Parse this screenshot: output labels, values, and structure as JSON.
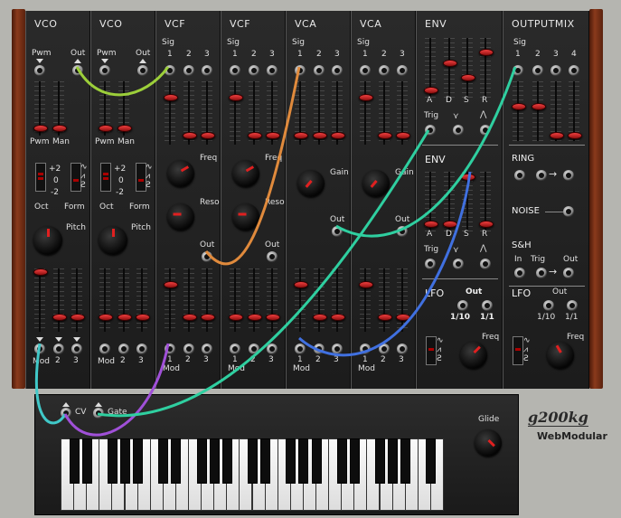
{
  "modules": {
    "vco1": {
      "title": "VCO",
      "pwm": "Pwm",
      "out": "Out",
      "pwm_label": "Pwm",
      "man_label": "Man",
      "oct": "Oct",
      "form": "Form",
      "pitch": "Pitch",
      "mod": "Mod",
      "n2": "2",
      "n3": "3",
      "plus2": "+2",
      "zero": "0",
      "minus2": "-2"
    },
    "vco2": {
      "title": "VCO",
      "pwm": "Pwm",
      "out": "Out",
      "pwm_label": "Pwm",
      "man_label": "Man",
      "oct": "Oct",
      "form": "Form",
      "pitch": "Pitch",
      "mod": "Mod",
      "n2": "2",
      "n3": "3",
      "plus2": "+2",
      "zero": "0",
      "minus2": "-2"
    },
    "vcf1": {
      "title": "VCF",
      "sig": "Sig",
      "n1": "1",
      "n2": "2",
      "n3": "3",
      "freq": "Freq",
      "reso": "Reso",
      "out": "Out",
      "mod": "Mod",
      "m1": "1",
      "m2": "2",
      "m3": "3"
    },
    "vcf2": {
      "title": "VCF",
      "sig": "Sig",
      "n1": "1",
      "n2": "2",
      "n3": "3",
      "freq": "Freq",
      "reso": "Reso",
      "out": "Out",
      "mod": "Mod",
      "m1": "1",
      "m2": "2",
      "m3": "3"
    },
    "vca1": {
      "title": "VCA",
      "sig": "Sig",
      "n1": "1",
      "n2": "2",
      "n3": "3",
      "gain": "Gain",
      "out": "Out",
      "mod": "Mod",
      "m1": "1",
      "m2": "2",
      "m3": "3"
    },
    "vca2": {
      "title": "VCA",
      "sig": "Sig",
      "n1": "1",
      "n2": "2",
      "n3": "3",
      "gain": "Gain",
      "out": "Out",
      "mod": "Mod",
      "m1": "1",
      "m2": "2",
      "m3": "3"
    },
    "env1": {
      "title": "ENV",
      "a": "A",
      "d": "D",
      "s": "S",
      "r": "R",
      "trig": "Trig"
    },
    "env2": {
      "title": "ENV",
      "a": "A",
      "d": "D",
      "s": "S",
      "r": "R",
      "trig": "Trig"
    },
    "lfo1": {
      "title": "LFO",
      "out": "Out",
      "r1": "1/10",
      "r2": "1/1",
      "freq": "Freq"
    },
    "outputmix": {
      "title": "OUTPUTMIX",
      "sig": "Sig",
      "n1": "1",
      "n2": "2",
      "n3": "3",
      "n4": "4",
      "ring": "RING",
      "noise": "NOISE",
      "sh": "S&H",
      "in": "In",
      "trig": "Trig",
      "out": "Out"
    },
    "lfo2": {
      "title": "LFO",
      "out": "Out",
      "r1": "1/10",
      "r2": "1/1",
      "freq": "Freq"
    }
  },
  "keyboard": {
    "cv": "CV",
    "gate": "Gate",
    "glide": "Glide"
  },
  "brand": {
    "logo": "g200kg",
    "product": "WebModular"
  },
  "colors": {
    "panel": "#222222",
    "knob_indicator": "#e02020",
    "cable_green": "#9ccf3a",
    "cable_orange": "#e08a3c",
    "cable_teal": "#2fcfa0",
    "cable_purple": "#a050d8",
    "cable_blue": "#4070e0",
    "cable_cyan": "#40c8c8"
  }
}
